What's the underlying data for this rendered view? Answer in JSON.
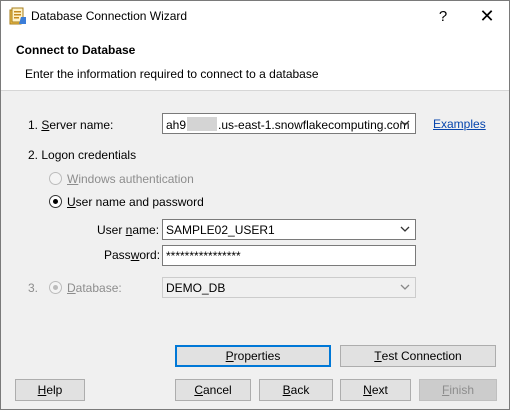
{
  "window": {
    "title": "Database Connection Wizard",
    "help_glyph": "?",
    "close_glyph": "✕"
  },
  "header": {
    "title": "Connect to Database",
    "subtitle": "Enter the information required to connect to a database"
  },
  "server": {
    "label_prefix": "1. ",
    "label_u": "S",
    "label_rest": "erver name:",
    "value_prefix": "ah9",
    "value_suffix": ".us-east-1.snowflakecomputing.com",
    "examples_link": "Examples"
  },
  "logon": {
    "label": "2. Logon credentials",
    "windows_auth_u": "W",
    "windows_auth_rest": "indows authentication",
    "windows_auth_selected": false,
    "userpass_u": "U",
    "userpass_rest": "ser name and password",
    "userpass_selected": true,
    "username_label_a": "User ",
    "username_label_u": "n",
    "username_label_b": "ame:",
    "username_value": "SAMPLE02_USER1",
    "password_label_a": "Pass",
    "password_label_u": "w",
    "password_label_b": "ord:",
    "password_value": "****************"
  },
  "database": {
    "label_number": "3.",
    "label_u": "D",
    "label_rest": "atabase:",
    "value": "DEMO_DB"
  },
  "buttons": {
    "properties_u": "P",
    "properties_rest": "roperties",
    "test_u": "T",
    "test_rest": "est Connection",
    "help_u": "H",
    "help_rest": "elp",
    "cancel_u": "C",
    "cancel_rest": "ancel",
    "back_u": "B",
    "back_rest": "ack",
    "next_u": "N",
    "next_rest": "ext",
    "finish_u": "F",
    "finish_rest": "inish"
  },
  "colors": {
    "link": "#0645ad",
    "focus_border": "#0078d7",
    "disabled_text": "#8d8d8d"
  }
}
